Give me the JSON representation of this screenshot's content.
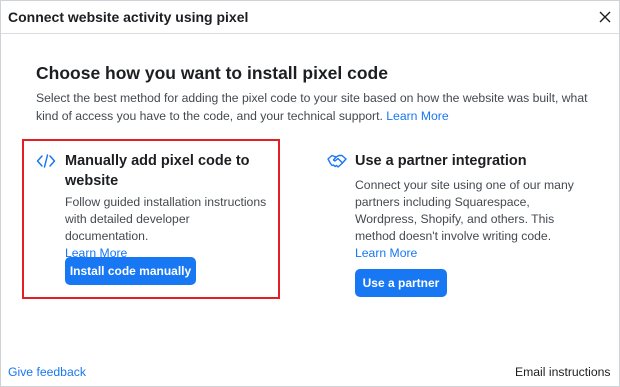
{
  "dialog": {
    "title": "Connect website activity using pixel",
    "close_icon": "close-icon"
  },
  "content": {
    "title": "Choose how you want to install pixel code",
    "description": "Select the best method for adding the pixel code to your site based on how the website was built, what kind of access you have to the code, and your technical support.",
    "learn_more": "Learn More"
  },
  "options": {
    "manual": {
      "icon": "code-icon",
      "title": "Manually add pixel code to website",
      "description": "Follow guided installation instructions with detailed developer documentation.",
      "learn_more": "Learn More",
      "button": "Install code manually"
    },
    "partner": {
      "icon": "handshake-icon",
      "title": "Use a partner integration",
      "description": "Connect your site using one of our many partners including Squarespace, Wordpress, Shopify, and others. This method doesn't involve writing code.",
      "learn_more": "Learn More",
      "button": "Use a partner"
    }
  },
  "footer": {
    "feedback": "Give feedback",
    "email": "Email instructions"
  },
  "colors": {
    "accent": "#1877f2",
    "highlight_border": "#e41e26"
  }
}
